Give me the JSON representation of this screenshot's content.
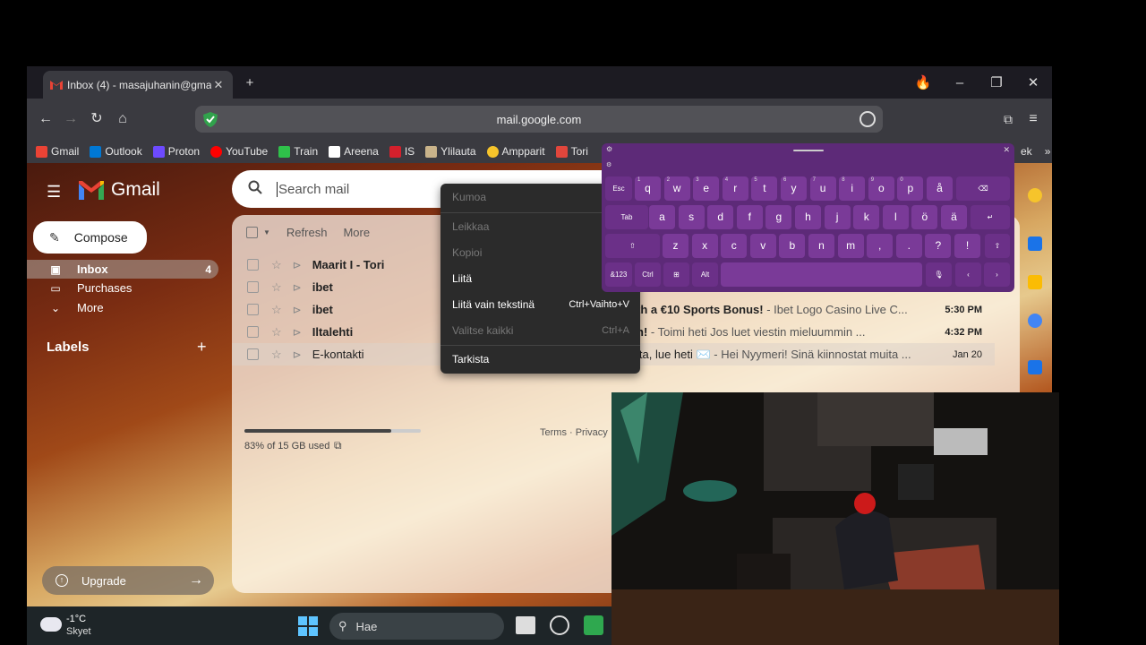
{
  "browser": {
    "tab_title": "Inbox (4) - masajuhanin@gma",
    "url": "mail.google.com",
    "bookmarks": [
      "Gmail",
      "Outlook",
      "Proton",
      "YouTube",
      "Train",
      "Areena",
      "IS",
      "Ylilauta",
      "Ampparit",
      "Tori"
    ],
    "bookmark_overflow": "ek"
  },
  "gmail": {
    "brand": "Gmail",
    "compose": "Compose",
    "nav": [
      {
        "label": "Inbox",
        "count": "4"
      },
      {
        "label": "Purchases",
        "count": ""
      },
      {
        "label": "More",
        "count": ""
      }
    ],
    "labels_heading": "Labels",
    "upgrade": "Upgrade",
    "search_placeholder": "Search mail",
    "toolbar": {
      "refresh": "Refresh",
      "more": "More"
    },
    "emails": [
      {
        "sender": "Maarit I - Tori",
        "subject": "",
        "snippet": "",
        "date": "",
        "read": false
      },
      {
        "sender": "ibet",
        "subject": "",
        "snippet": "",
        "date": "",
        "read": false
      },
      {
        "sender": "ibet",
        "subject": "th a €10 Sports Bonus!",
        "snippet": " - Ibet Logo Casino Live C...",
        "date": "5:30 PM",
        "read": false
      },
      {
        "sender": "Iltalehti",
        "subject": "n!",
        "snippet": " - Toimi heti            Jos luet viestin mieluummin ...",
        "date": "4:32 PM",
        "read": false
      },
      {
        "sender": "E-kontakti",
        "subject": "lta, lue heti ✉️",
        "snippet": " - Hei Nyymeri! Sinä kiinnostat muita ...",
        "date": "Jan 20",
        "read": true
      }
    ],
    "storage_text": "83% of 15 GB used",
    "storage_fraction": 0.83,
    "terms": "Terms · Privacy ·"
  },
  "context_menu": [
    {
      "label": "Kumoa",
      "shortcut": "",
      "disabled": true
    },
    {
      "label": "Leikkaa",
      "shortcut": "",
      "disabled": true
    },
    {
      "label": "Kopioi",
      "shortcut": "",
      "disabled": true
    },
    {
      "label": "Liitä",
      "shortcut": "C",
      "disabled": false
    },
    {
      "label": "Liitä vain tekstinä",
      "shortcut": "Ctrl+Vaihto+V",
      "disabled": false
    },
    {
      "label": "Valitse kaikki",
      "shortcut": "Ctrl+A",
      "disabled": true
    },
    {
      "label": "Tarkista",
      "shortcut": "",
      "disabled": false
    }
  ],
  "keyboard": {
    "row1": [
      "q",
      "w",
      "e",
      "r",
      "t",
      "y",
      "u",
      "i",
      "o",
      "p",
      "å"
    ],
    "row1_sup": [
      "1",
      "2",
      "3",
      "4",
      "5",
      "6",
      "7",
      "8",
      "9",
      "0",
      ""
    ],
    "row2": [
      "a",
      "s",
      "d",
      "f",
      "g",
      "h",
      "j",
      "k",
      "l",
      "ö",
      "ä"
    ],
    "row3": [
      "z",
      "x",
      "c",
      "v",
      "b",
      "n",
      "m",
      ",",
      ".",
      "?",
      "!"
    ],
    "esc": "Esc",
    "tab": "Tab",
    "sym": "&123",
    "ctrl": "Ctrl",
    "alt": "Alt"
  },
  "taskbar": {
    "temperature": "-1°C",
    "weather": "Skyet",
    "search": "Hae"
  }
}
